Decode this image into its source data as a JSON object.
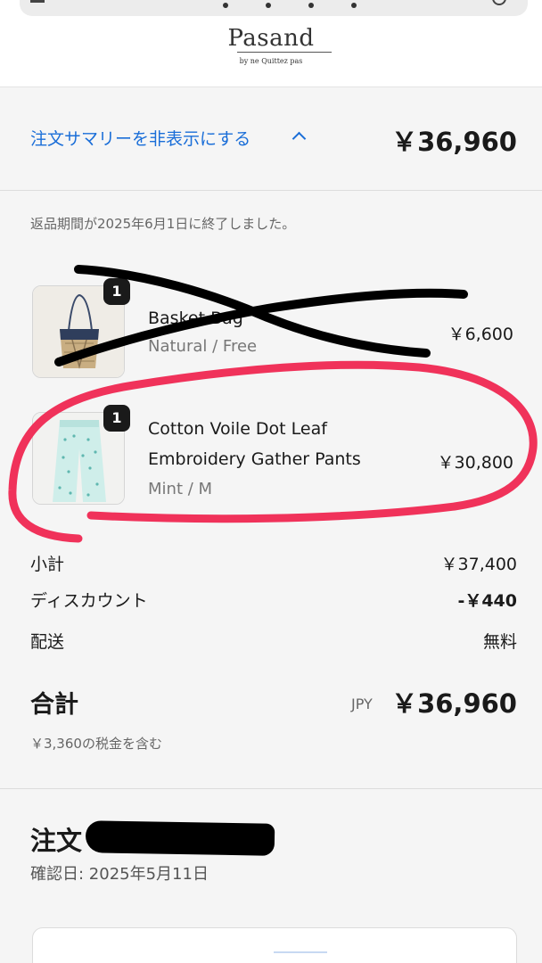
{
  "shop": {
    "logo_name": "Pasand",
    "logo_sub": "by ne Quittez pas"
  },
  "summary": {
    "toggle_label": "注文サマリーを非表示にする",
    "toggle_total": "￥36,960"
  },
  "return_note": "返品期間が2025年6月1日に終了しました。",
  "items": [
    {
      "qty": "1",
      "name_line1": "Basket Bag",
      "name_line2": "",
      "variant": "Natural / Free",
      "price": "￥6,600"
    },
    {
      "qty": "1",
      "name_line1": "Cotton Voile Dot Leaf",
      "name_line2": "Embroidery Gather Pants",
      "variant": "Mint / M",
      "price": "￥30,800"
    }
  ],
  "totals": {
    "subtotal_label": "小計",
    "subtotal_value": "￥37,400",
    "discount_label": "ディスカウント",
    "discount_value": "-￥440",
    "shipping_label": "配送",
    "shipping_value": "無料",
    "grand_label": "合計",
    "currency": "JPY",
    "grand_value": "￥36,960",
    "tax_note": "￥3,360の税金を含む"
  },
  "order": {
    "title": "注文",
    "confirm_date": "確認日: 2025年5月11日"
  },
  "colors": {
    "link": "#1a6ed8",
    "annotation_pink": "#f0325a",
    "annotation_black": "#000000"
  }
}
